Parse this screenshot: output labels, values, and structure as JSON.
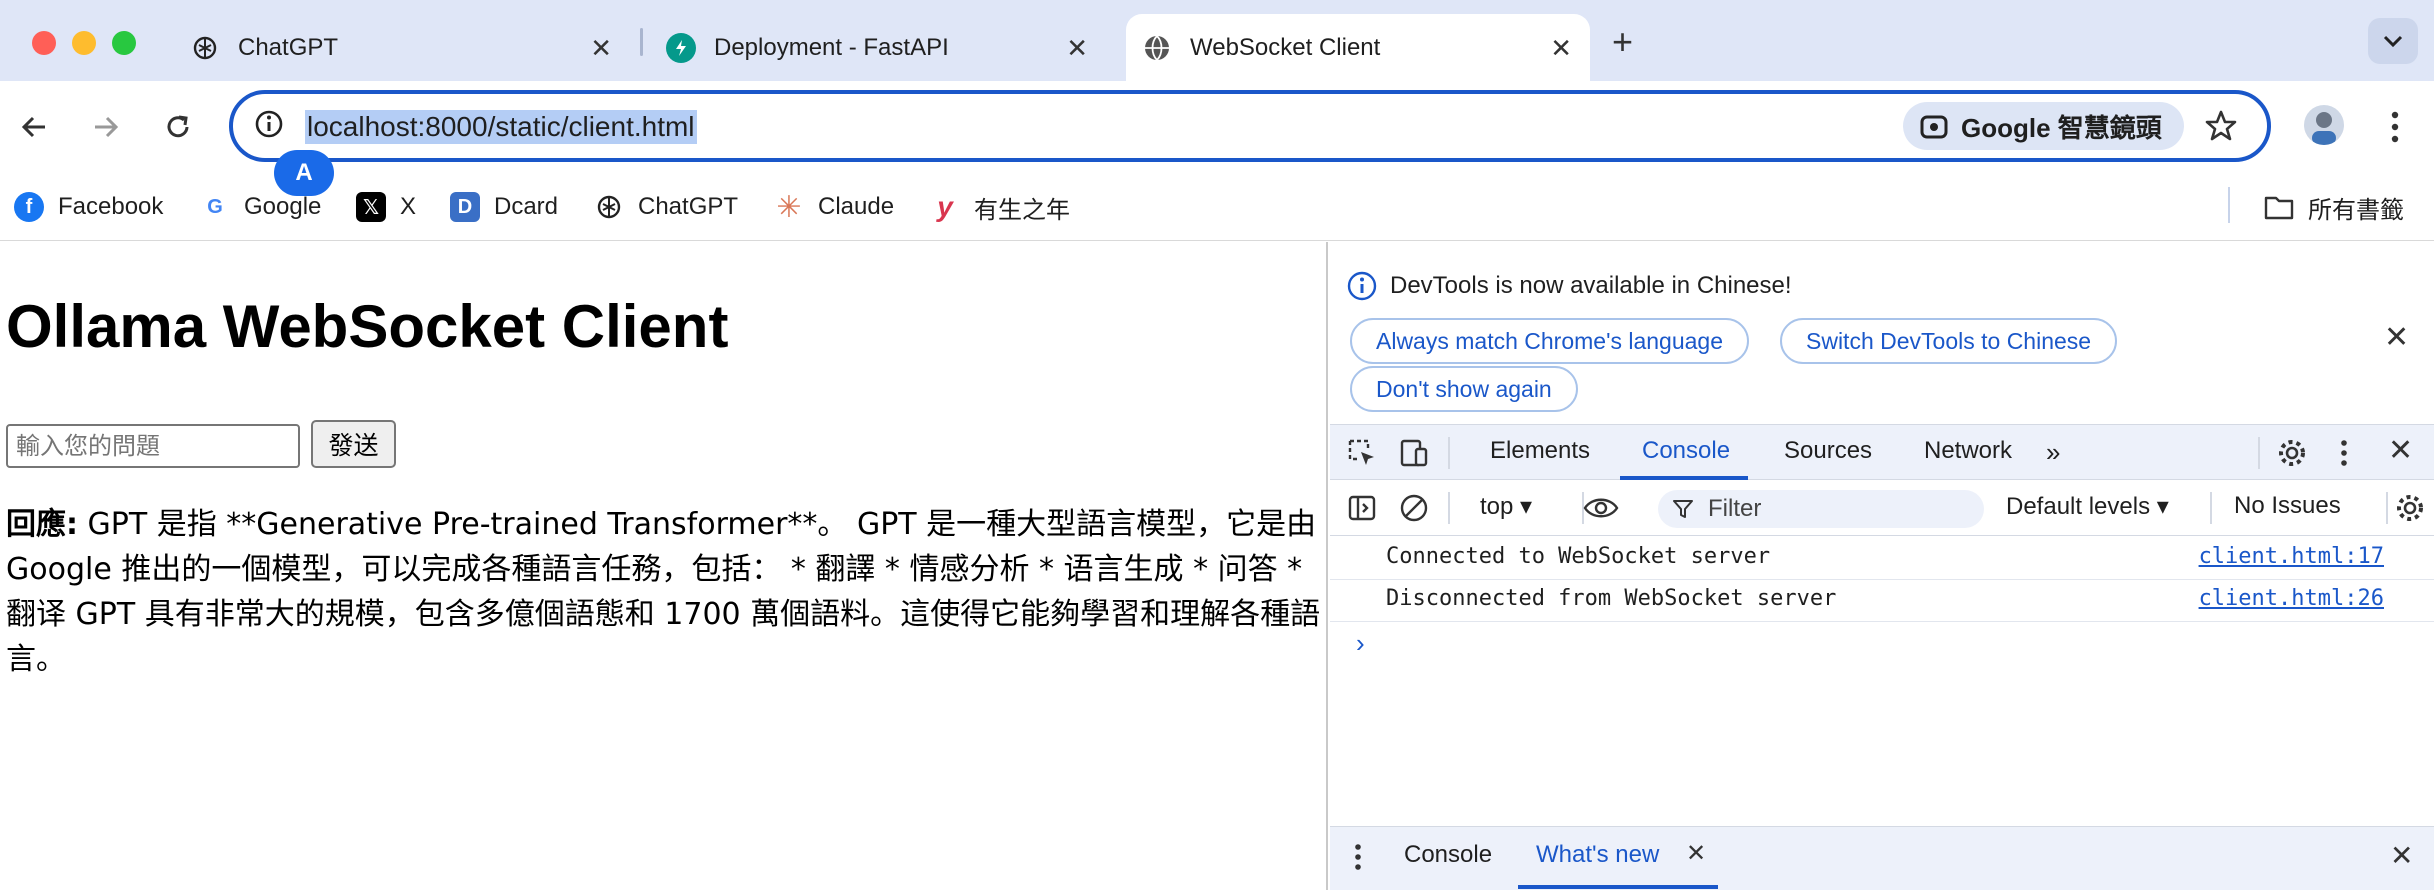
{
  "browser": {
    "tabs": [
      {
        "title": "ChatGPT",
        "icon": "chatgpt-icon"
      },
      {
        "title": "Deployment - FastAPI",
        "icon": "fastapi-icon"
      },
      {
        "title": "WebSocket Client",
        "icon": "globe-icon"
      }
    ],
    "url": "localhost:8000/static/client.html",
    "lens_label": "Google 智慧鏡頭",
    "profile_badge": "A",
    "bookmarks": [
      {
        "label": "Facebook",
        "icon": "facebook-icon"
      },
      {
        "label": "Google",
        "icon": "google-icon"
      },
      {
        "label": "X",
        "icon": "x-icon"
      },
      {
        "label": "Dcard",
        "icon": "dcard-icon"
      },
      {
        "label": "ChatGPT",
        "icon": "chatgpt-icon"
      },
      {
        "label": "Claude",
        "icon": "claude-icon"
      },
      {
        "label": "有生之年",
        "icon": "y-icon"
      }
    ],
    "all_bookmarks": "所有書籤"
  },
  "page": {
    "title": "Ollama WebSocket Client",
    "input_placeholder": "輸入您的問題",
    "send_label": "發送",
    "response_label": "回應:",
    "response_text": " GPT 是指 **Generative Pre-trained Transformer**。 GPT 是一種大型語言模型，它是由 Google 推出的一個模型，可以完成各種語言任務，包括： * 翻譯 * 情感分析 * 语言生成 * 问答 * 翻译 GPT 具有非常大的規模，包含多億個語態和 1700 萬個語料。這使得它能夠學習和理解各種語言。"
  },
  "devtools": {
    "banner_text": "DevTools is now available in Chinese!",
    "banner_buttons": [
      "Always match Chrome's language",
      "Switch DevTools to Chinese",
      "Don't show again"
    ],
    "tabs": [
      "Elements",
      "Console",
      "Sources",
      "Network"
    ],
    "active_tab": "Console",
    "context": "top",
    "filter_placeholder": "Filter",
    "levels": "Default levels",
    "issues": "No Issues",
    "logs": [
      {
        "message": "Connected to WebSocket server",
        "source": "client.html:17"
      },
      {
        "message": "Disconnected from WebSocket server",
        "source": "client.html:26"
      }
    ],
    "drawer_tabs": [
      "Console",
      "What's new"
    ],
    "drawer_active": "What's new"
  },
  "colors": {
    "accent": "#1a57c9",
    "tabstrip": "#dfe6f7",
    "url_highlight": "#b4cdf5"
  }
}
